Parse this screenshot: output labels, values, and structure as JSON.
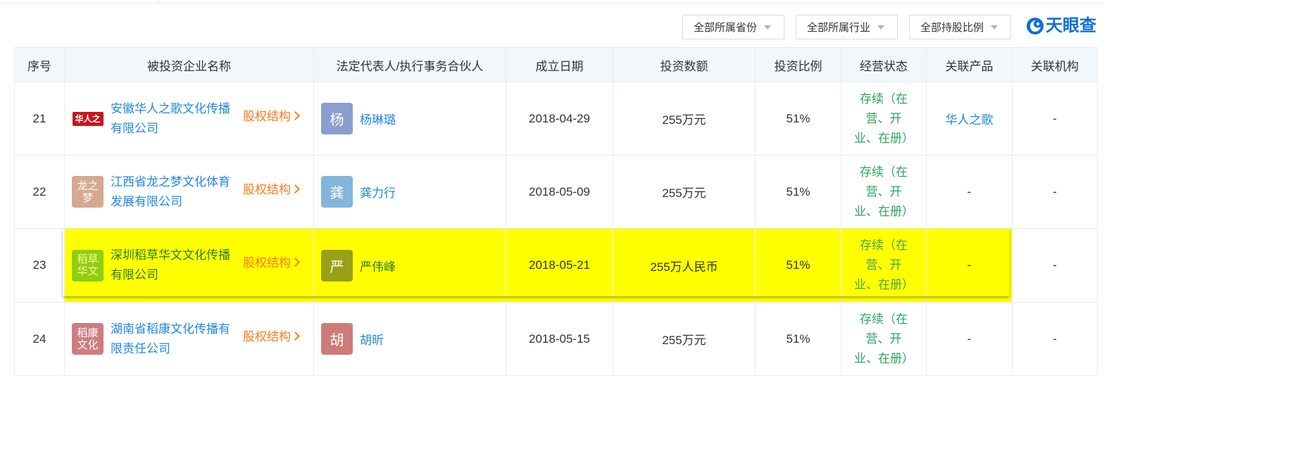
{
  "filters": [
    {
      "label": "全部所属省份"
    },
    {
      "label": "全部所属行业"
    },
    {
      "label": "全部持股比例"
    }
  ],
  "logo": {
    "text": "天眼查",
    "icon": "tianyancha-logo-icon",
    "color": "#0c6fd9"
  },
  "table": {
    "headers": [
      "序号",
      "被投资企业名称",
      "法定代表人/执行事务合伙人",
      "成立日期",
      "投资数额",
      "投资比例",
      "经营状态",
      "关联产品",
      "关联机构"
    ],
    "equity_label": "股权结构",
    "rows": [
      {
        "seq": "21",
        "logo_text": "华人之歌",
        "company": "安徽华人之歌文化传播有限公司",
        "rep_avatar": "杨",
        "rep": "杨琳璐",
        "date": "2018-04-29",
        "amount": "255万元",
        "ratio": "51%",
        "state": "存续（在营、开业、在册）",
        "product": "华人之歌",
        "org": "-",
        "highlighted": false
      },
      {
        "seq": "22",
        "logo_text": "龙之梦",
        "company": "江西省龙之梦文化体育发展有限公司",
        "rep_avatar": "龚",
        "rep": "龚力行",
        "date": "2018-05-09",
        "amount": "255万元",
        "ratio": "51%",
        "state": "存续（在营、开业、在册）",
        "product": "-",
        "org": "-",
        "highlighted": false
      },
      {
        "seq": "23",
        "logo_text": "稻草华文",
        "company": "深圳稻草华文文化传播有限公司",
        "rep_avatar": "严",
        "rep": "严伟峰",
        "date": "2018-05-21",
        "amount": "255万人民币",
        "ratio": "51%",
        "state": "存续（在营、开业、在册）",
        "product": "-",
        "org": "-",
        "highlighted": true
      },
      {
        "seq": "24",
        "logo_text": "稻康文化",
        "company": "湖南省稻康文化传播有限责任公司",
        "rep_avatar": "胡",
        "rep": "胡昕",
        "date": "2018-05-15",
        "amount": "255万元",
        "ratio": "51%",
        "state": "存续（在营、开业、在册）",
        "product": "-",
        "org": "-",
        "highlighted": false
      }
    ]
  },
  "colors": {
    "link": "#1f87e8",
    "equity": "#ff7a1a",
    "state": "#2fa55b",
    "highlight": "#ffff00"
  }
}
